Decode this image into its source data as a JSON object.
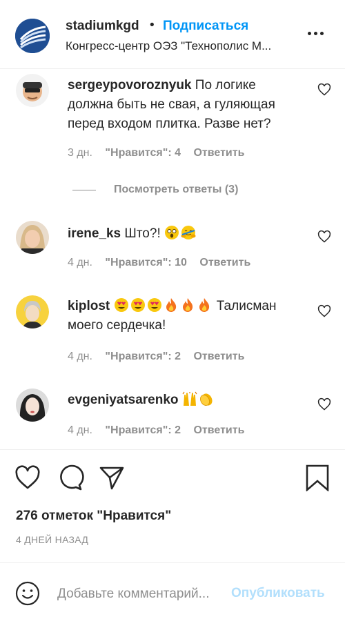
{
  "header": {
    "username": "stadiumkgd",
    "separator": "•",
    "follow_label": "Подписаться",
    "location": "Конгресс-центр ОЭЗ \"Технополис М...",
    "more_icon": "more-horizontal-icon"
  },
  "comments": [
    {
      "username": "sergeypovoroznyuk",
      "text": "По логике должна быть не свая, а гуляющая перед входом плитка. Разве нет?",
      "time": "3 дн.",
      "likes": "\"Нравится\": 4",
      "reply": "Ответить"
    },
    {
      "username": "irene_ks",
      "text": "Што?!",
      "time": "4 дн.",
      "likes": "\"Нравится\": 10",
      "reply": "Ответить"
    },
    {
      "username": "kiplost",
      "text": "Талисман моего сердечка!",
      "time": "4 дн.",
      "likes": "\"Нравится\": 2",
      "reply": "Ответить"
    },
    {
      "username": "evgeniyatsarenko",
      "text": "",
      "time": "4 дн.",
      "likes": "\"Нравится\": 2",
      "reply": "Ответить"
    }
  ],
  "view_replies": "Посмотреть ответы (3)",
  "actions": {
    "like_icon": "heart-icon",
    "comment_icon": "comment-icon",
    "share_icon": "share-icon",
    "save_icon": "bookmark-icon"
  },
  "likes_count": "276 отметок \"Нравится\"",
  "time_ago": "4 ДНЕЙ НАЗАД",
  "add_comment": {
    "placeholder": "Добавьте комментарий...",
    "post_label": "Опубликовать"
  },
  "colors": {
    "link_blue": "#0095f6",
    "post_disabled": "#b2dffc",
    "secondary_text": "#8e8e8e"
  }
}
